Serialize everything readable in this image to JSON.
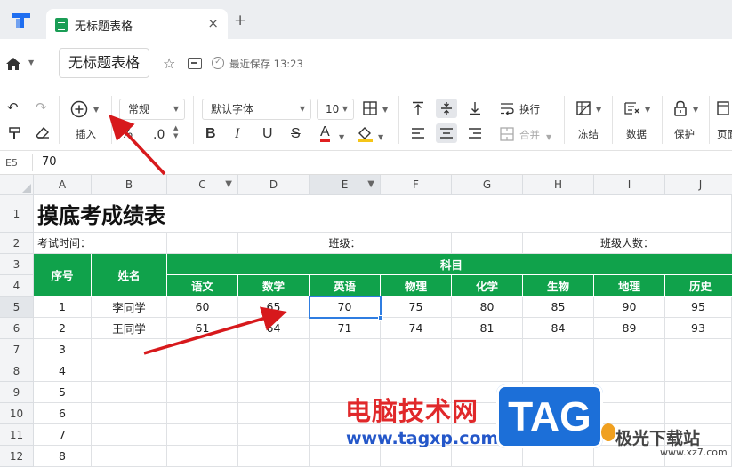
{
  "tab": {
    "title": "无标题表格",
    "close": "×",
    "new": "+"
  },
  "titlebar": {
    "doc_title": "无标题表格",
    "save_status": "最近保存 13:23"
  },
  "toolbar": {
    "insert_label": "插入",
    "number_format": "常规",
    "decimal": ".0",
    "font_name": "默认字体",
    "font_size": "10",
    "bold": "B",
    "italic": "I",
    "underline": "U",
    "strike": "S",
    "font_color": "A",
    "wrap_label": "换行",
    "merge_label": "合并",
    "freeze_label": "冻结",
    "data_label": "数据",
    "protect_label": "保护",
    "page_label": "页面"
  },
  "formula_bar": {
    "cell_ref": "E5",
    "value": "70"
  },
  "columns": [
    "A",
    "B",
    "C",
    "D",
    "E",
    "F",
    "G",
    "H",
    "I",
    "J"
  ],
  "rows": [
    "1",
    "2",
    "3",
    "4",
    "5",
    "6",
    "7",
    "8",
    "9",
    "10",
    "11",
    "12"
  ],
  "sheet": {
    "title": "摸底考成绩表",
    "exam_time": "考试时间：",
    "class_label": "班级：",
    "class_size": "班级人数：",
    "h_no": "序号",
    "h_name": "姓名",
    "h_subjects": "科目",
    "subjects": [
      "语文",
      "数学",
      "英语",
      "物理",
      "化学",
      "生物",
      "地理",
      "历史"
    ],
    "students": [
      {
        "no": "1",
        "name": "李同学",
        "scores": [
          "60",
          "65",
          "70",
          "75",
          "80",
          "85",
          "90",
          "95"
        ]
      },
      {
        "no": "2",
        "name": "王同学",
        "scores": [
          "61",
          "64",
          "71",
          "74",
          "81",
          "84",
          "89",
          "93"
        ]
      }
    ],
    "extra_nos": [
      "3",
      "4",
      "5",
      "6",
      "7",
      "8"
    ]
  },
  "watermark": {
    "line1": "电脑技术网",
    "tag": "TAG",
    "url": "www.tagxp.com",
    "brand": "极光下载站",
    "brand_url": "www.xz7.com"
  },
  "colors": {
    "header_green": "#10a24b",
    "accent_blue": "#2f7de1",
    "arrow_red": "#d7191c"
  }
}
